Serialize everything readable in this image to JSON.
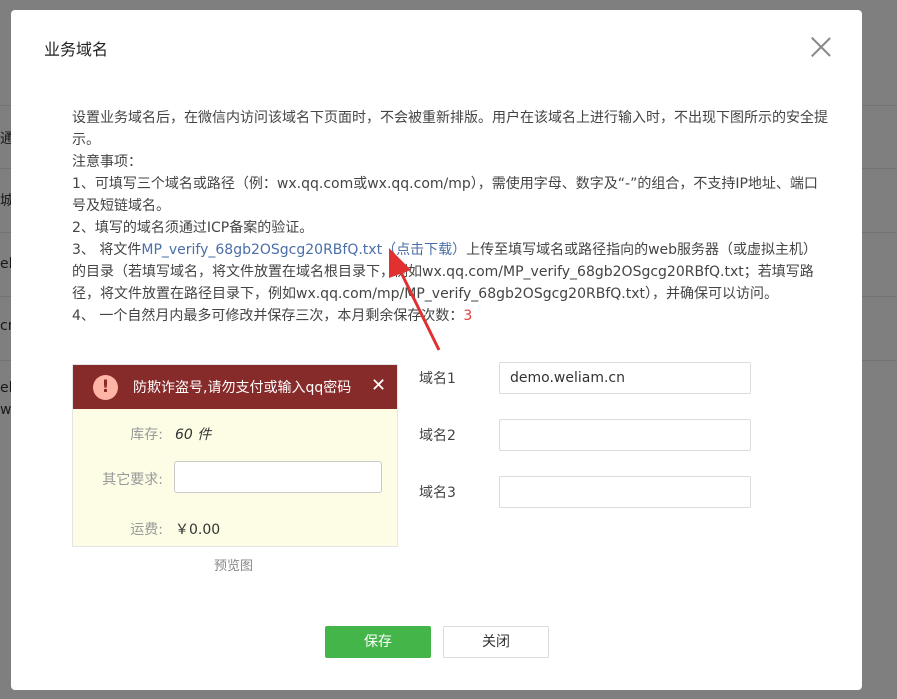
{
  "background": {
    "fragments": [
      "通",
      "城",
      "el",
      "cn",
      "el",
      "w"
    ]
  },
  "dialog": {
    "title": "业务域名",
    "description": {
      "line1": "设置业务域名后，在微信内访问该域名下页面时，不会被重新排版。用户在该域名上进行输入时，不出现下图所示的安全提示。",
      "notes_title": "注意事项：",
      "note1": "1、可填写三个域名或路径（例：wx.qq.com或wx.qq.com/mp），需使用字母、数字及“-”的组合，不支持IP地址、端口号及短链域名。",
      "note2": "2、填写的域名须通过ICP备案的验证。",
      "note3_prefix": "3、 将文件",
      "note3_file": "MP_verify_68gb2OSgcg20RBfQ.txt",
      "note3_download": "（点击下载）",
      "note3_suffix": "上传至填写域名或路径指向的web服务器（或虚拟主机）的目录（若填写域名，将文件放置在域名根目录下，例如wx.qq.com/MP_verify_68gb2OSgcg20RBfQ.txt；若填写路径，将文件放置在路径目录下，例如wx.qq.com/mp/MP_verify_68gb2OSgcg20RBfQ.txt），并确保可以访问。",
      "note4_prefix": "4、 一个自然月内最多可修改并保存三次，本月剩余保存次数：",
      "note4_count": "3"
    },
    "preview": {
      "warning_text": "防欺诈盗号,请勿支付或输入qq密码",
      "warning_icon": "!",
      "close_icon": "✕",
      "stock_label": "库存:",
      "stock_value": "60 件",
      "other_label": "其它要求:",
      "shipping_label": "运费:",
      "shipping_value": "￥0.00",
      "caption": "预览图"
    },
    "domains": [
      {
        "label": "域名1",
        "value": "demo.weliam.cn"
      },
      {
        "label": "域名2",
        "value": ""
      },
      {
        "label": "域名3",
        "value": ""
      }
    ],
    "buttons": {
      "save": "保存",
      "close": "关闭"
    },
    "colors": {
      "save_green": "#44b549",
      "warning_bar": "#862a2a",
      "link": "#4a6ea8",
      "count_red": "#e43b3b",
      "arrow_red": "#e03030"
    }
  }
}
